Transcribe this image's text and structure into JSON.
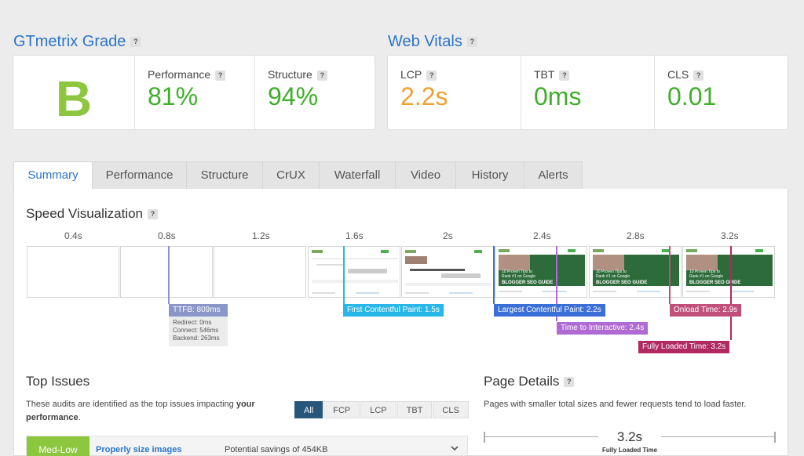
{
  "grade": {
    "title": "GTmetrix Grade",
    "letter": "B",
    "performance": {
      "label": "Performance",
      "value": "81%"
    },
    "structure": {
      "label": "Structure",
      "value": "94%"
    }
  },
  "web_vitals": {
    "title": "Web Vitals",
    "lcp": {
      "label": "LCP",
      "value": "2.2s"
    },
    "tbt": {
      "label": "TBT",
      "value": "0ms"
    },
    "cls": {
      "label": "CLS",
      "value": "0.01"
    }
  },
  "help_icon_glyph": "?",
  "tabs": [
    "Summary",
    "Performance",
    "Structure",
    "CrUX",
    "Waterfall",
    "Video",
    "History",
    "Alerts"
  ],
  "speed_viz": {
    "title": "Speed Visualization",
    "times": [
      "0.4s",
      "0.8s",
      "1.2s",
      "1.6s",
      "2s",
      "2.4s",
      "2.8s",
      "3.2s"
    ],
    "ttfb": {
      "label": "TTFB: 809ms",
      "redirect": "Redirect: 0ms",
      "connect": "Connect: 546ms",
      "backend": "Backend: 263ms"
    },
    "markers": {
      "fcp": "First Contentful Paint: 1.5s",
      "lcp": "Largest Contentful Paint: 2.2s",
      "tti": "Time to Interactive: 2.4s",
      "onload": "Onload Time: 2.9s",
      "fully_loaded": "Fully Loaded Time: 3.2s"
    },
    "thumb_text": [
      "10 Proven Tips to",
      "Rank #1 on Google",
      "BLOGGER SEO GUIDE"
    ]
  },
  "top_issues": {
    "title": "Top Issues",
    "desc_a": "These audits are identified as the top issues impacting ",
    "desc_b": "your performance",
    "desc_c": ".",
    "filters": [
      "All",
      "FCP",
      "LCP",
      "TBT",
      "CLS"
    ],
    "row": {
      "severity": "Med-Low",
      "name": "Properly size images",
      "savings": "Potential savings of 454KB"
    }
  },
  "page_details": {
    "title": "Page Details",
    "desc": "Pages with smaller total sizes and fewer requests tend to load faster.",
    "metric_value": "3.2s",
    "metric_label": "Fully Loaded Time"
  },
  "colors": {
    "accent": "#2b74c8",
    "good": "#3fae2a",
    "warn": "#f0a030",
    "ttfb": "#8a96c8",
    "fcp": "#29b6e8",
    "lcp": "#3b6fd8",
    "tti": "#b06ad4",
    "onload": "#c0507a",
    "fully_loaded": "#b02a60"
  }
}
